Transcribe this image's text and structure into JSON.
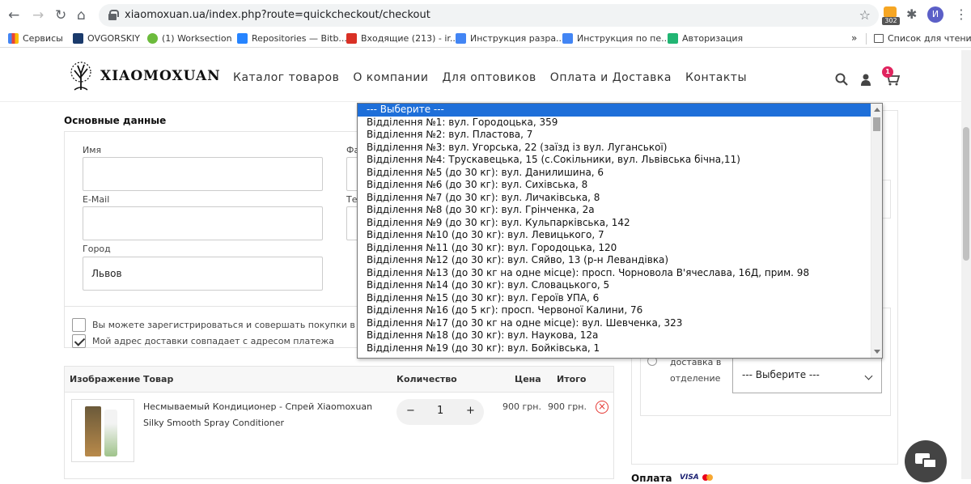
{
  "browser": {
    "url": "xiaomoxuan.ua/index.php?route=quickcheckout/checkout",
    "extension_badge": "302",
    "profile_initial": "И",
    "bookmarks": [
      {
        "label": "Сервисы",
        "color": "#4285f4"
      },
      {
        "label": "OVGORSKIY",
        "color": "#1a3a6b"
      },
      {
        "label": "(1) Worksection",
        "color": "#6cbb3c"
      },
      {
        "label": "Repositories — Bitb...",
        "color": "#2684ff"
      },
      {
        "label": "Входящие (213) - ir...",
        "color": "#d93025"
      },
      {
        "label": "Инструкция разра...",
        "color": "#4285f4"
      },
      {
        "label": "Инструкция по пе...",
        "color": "#4285f4"
      },
      {
        "label": "Авторизация",
        "color": "#21b573"
      }
    ],
    "bookmarks_more": "»",
    "reading_list": "Список для чтения"
  },
  "site": {
    "logo": "XIAOMOXUAN",
    "menu": [
      "Каталог товаров",
      "О компании",
      "Для оптовиков",
      "Оплата и Доставка",
      "Контакты"
    ],
    "cart_count": "1"
  },
  "checkout": {
    "section_title": "Основные данные",
    "fields": {
      "name_label": "Имя",
      "email_label": "E-Mail",
      "city_label": "Город",
      "city_value": "Львов",
      "surname_label_partial": "Фа",
      "phone_label_partial": "Те"
    },
    "register_text": "Вы можете зарегистрироваться и совершать покупки в пару",
    "same_address_text": "Мой адрес доставки совпадает с адресом платежа"
  },
  "products": {
    "headers": [
      "Изображение",
      "Товар",
      "Количество",
      "Цена",
      "Итого"
    ],
    "rows": [
      {
        "name": "Несмываемый Кондиционер - Спрей Xiaomoxuan Silky Smooth Spray Conditioner",
        "qty": "1",
        "minus": "−",
        "plus": "+",
        "price": "900 грн.",
        "total": "900 грн."
      }
    ]
  },
  "delivery": {
    "option_text": "доставка в отделение",
    "select_value": "--- Выберите ---"
  },
  "payment": {
    "label": "Оплата",
    "visa": "VISA"
  },
  "dropdown": {
    "options": [
      "--- Выберите ---",
      "Відділення №1: вул. Городоцька, 359",
      "Відділення №2: вул. Пластова, 7",
      "Відділення №3: вул. Угорська, 22 (заїзд із вул. Луганської)",
      "Відділення №4: Трускавецька, 15 (с.Сокільники, вул. Львівська бічна,11)",
      "Відділення №5 (до 30 кг): вул. Данилишина, 6",
      "Відділення №6 (до 30 кг): вул. Сихівська, 8",
      "Відділення №7 (до 30 кг): вул. Личаківська, 8",
      "Відділення №8 (до 30 кг): вул. Грінченка, 2а",
      "Відділення №9 (до 30 кг): вул. Кульпарківська, 142",
      "Відділення №10 (до 30 кг): вул. Левицького, 7",
      "Відділення №11 (до 30 кг): вул. Городоцька, 120",
      "Відділення №12 (до 30 кг): вул. Сяйво, 13 (р-н Левандівка)",
      "Відділення №13 (до 30 кг на одне місце): просп. Чорновола В'ячеслава, 16Д, прим. 98",
      "Відділення №14 (до 30 кг): вул. Словацького, 5",
      "Відділення №15 (до 30 кг): вул. Героїв УПА, 6",
      "Відділення №16 (до 5 кг): просп. Червоної Калини, 76",
      "Відділення №17 (до 30 кг на одне місце): вул. Шевченка, 323",
      "Відділення №18 (до 30 кг): вул. Наукова, 12а",
      "Відділення №19 (до 30 кг): вул. Бойківська, 1"
    ],
    "selected_index": 0
  }
}
